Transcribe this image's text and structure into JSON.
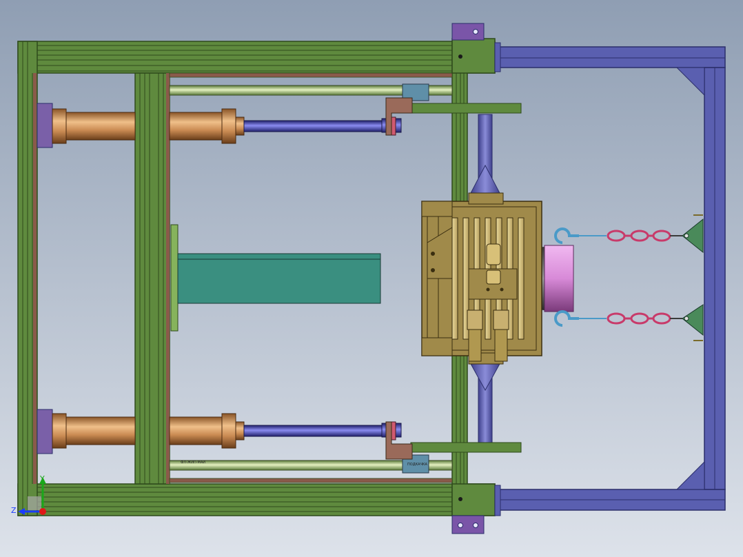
{
  "view": {
    "background_top": "#8f9eb3",
    "background_bottom": "#dde2ea"
  },
  "colors": {
    "frame_green": "#5f8a3e",
    "frame_green_dark": "#2f4a1c",
    "frame_green_light": "#86b35c",
    "purple_frame": "#5a5fb0",
    "purple_dark": "#2b2e6a",
    "cylinder_copper": "#c98a52",
    "rod_blue": "#3d3fc0",
    "teal_plate": "#3a8f80",
    "olive_fixture": "#a08a4a",
    "pink_disc": "#d88ad8",
    "chain_red": "#c83a6a",
    "hook_blue": "#4a9ac8",
    "bracket_brown": "#9a6a5a",
    "block_steel": "#5f8fa8",
    "plate_purple": "#7a55a8",
    "axis_green": "#1aa81a",
    "axis_red": "#e01818",
    "axis_blue": "#1a3cff"
  },
  "triad": {
    "y_label": "Y",
    "z_label": "Z"
  },
  "annotations": {
    "bottom_rail_label": "ФЛ-ЖИП-МАИ",
    "block_label": "ПОДКАЧКА"
  }
}
